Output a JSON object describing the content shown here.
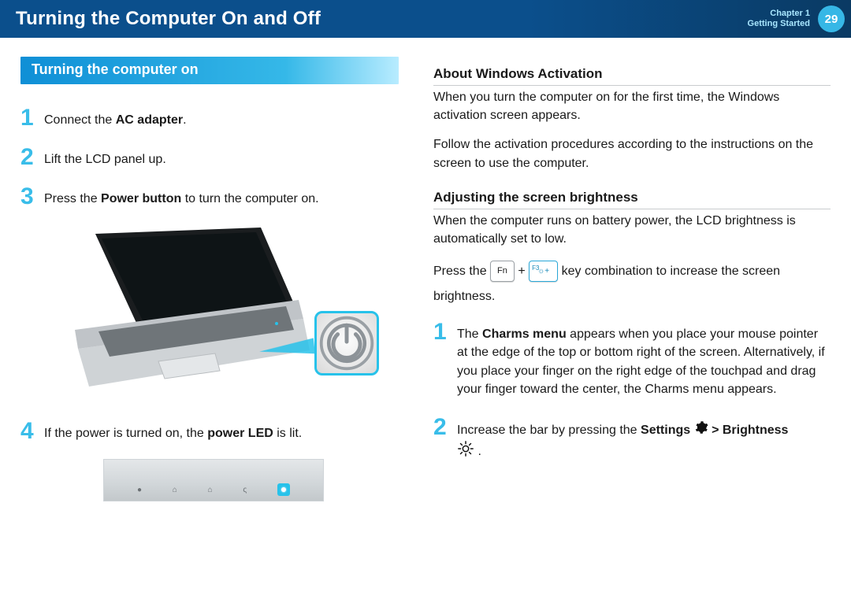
{
  "header": {
    "title": "Turning the Computer On and Off",
    "chapter_line1": "Chapter 1",
    "chapter_line2": "Getting Started",
    "page_number": "29"
  },
  "section_banner": "Turning the computer on",
  "left_steps": {
    "s1": {
      "num": "1",
      "pre": "Connect the ",
      "bold": "AC adapter",
      "post": "."
    },
    "s2": {
      "num": "2",
      "text": "Lift the LCD panel up."
    },
    "s3": {
      "num": "3",
      "pre": "Press the ",
      "bold": "Power button",
      "post": " to turn the computer on."
    },
    "s4": {
      "num": "4",
      "pre": "If the power is turned on, the ",
      "bold": "power LED",
      "post": " is lit."
    }
  },
  "right": {
    "h1": "About Windows Activation",
    "p1": "When you turn the computer on for the first time, the Windows activation screen appears.",
    "p2": "Follow the activation procedures according to the instructions on the screen to use the computer.",
    "h2": "Adjusting the screen brightness",
    "p3": "When the computer runs on battery power, the LCD brightness is automatically set to low.",
    "keyline": {
      "pre": "Press the ",
      "fn": "Fn",
      "plus": " + ",
      "f3_label": "F3",
      "mid": " key combination to increase the screen",
      "post": "brightness."
    },
    "steps": {
      "s1": {
        "num": "1",
        "pre": "The ",
        "bold": "Charms menu",
        "post": " appears when you place your mouse pointer at the edge of the top or bottom right of the screen. Alternatively, if you place your finger on the right edge of the touchpad and drag your finger toward the center, the Charms menu appears."
      },
      "s2": {
        "num": "2",
        "pre": "Increase the bar by pressing the ",
        "bold1": "Settings",
        "mid": " > ",
        "bold2": "Brightness",
        "tail": "."
      }
    }
  },
  "icons": {
    "power": "power-icon",
    "gear": "gear-icon",
    "brightness_small": "brightness-up-icon",
    "brightness_large": "brightness-icon"
  }
}
